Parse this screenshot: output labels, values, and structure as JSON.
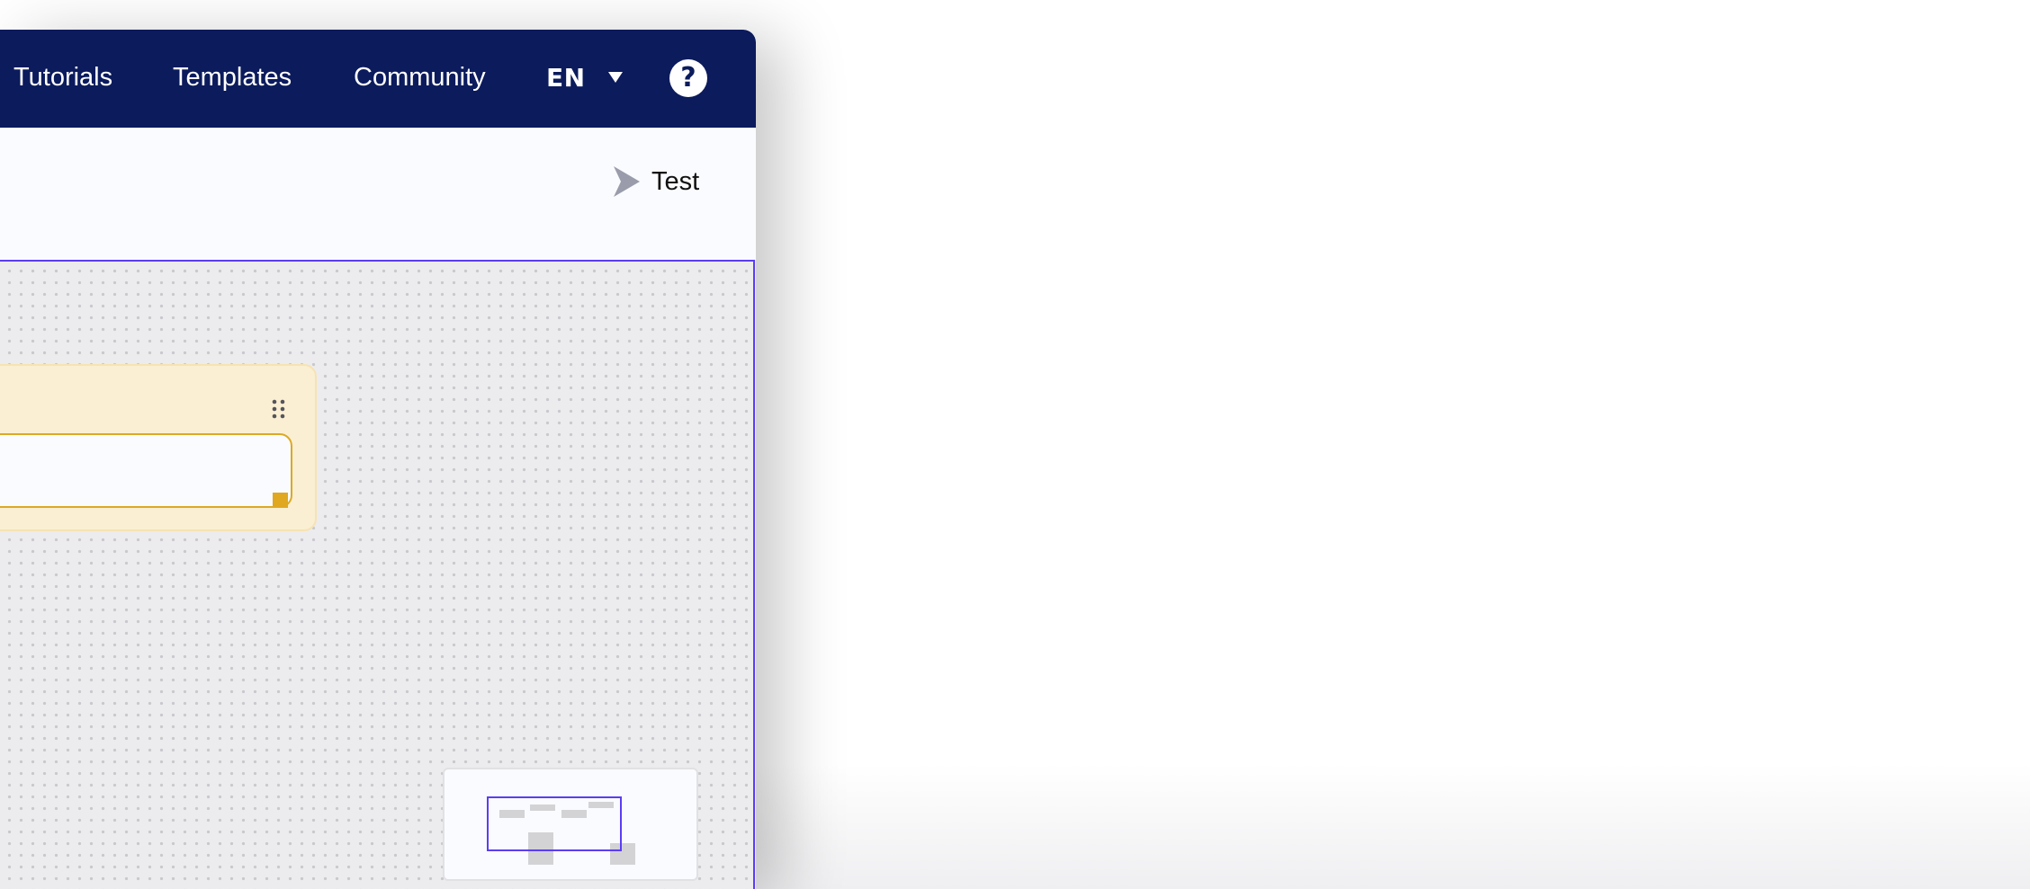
{
  "navbar": {
    "links": [
      "Tutorials",
      "Templates",
      "Community"
    ],
    "language": {
      "code": "EN",
      "caret_icon": "caret-down-icon"
    },
    "help_icon": "question-circle-icon",
    "help_glyph": "?"
  },
  "toolbar": {
    "test_label": "Test",
    "test_icon": "play-arrow-icon"
  },
  "colors": {
    "navbar_bg": "#0b1b5c",
    "accent": "#5b3df5",
    "node_bg": "#faefd2",
    "node_border": "#dca925",
    "resize_handle": "#e0a721"
  },
  "node": {
    "drag_icon": "drag-dots-icon",
    "input_value": ""
  }
}
